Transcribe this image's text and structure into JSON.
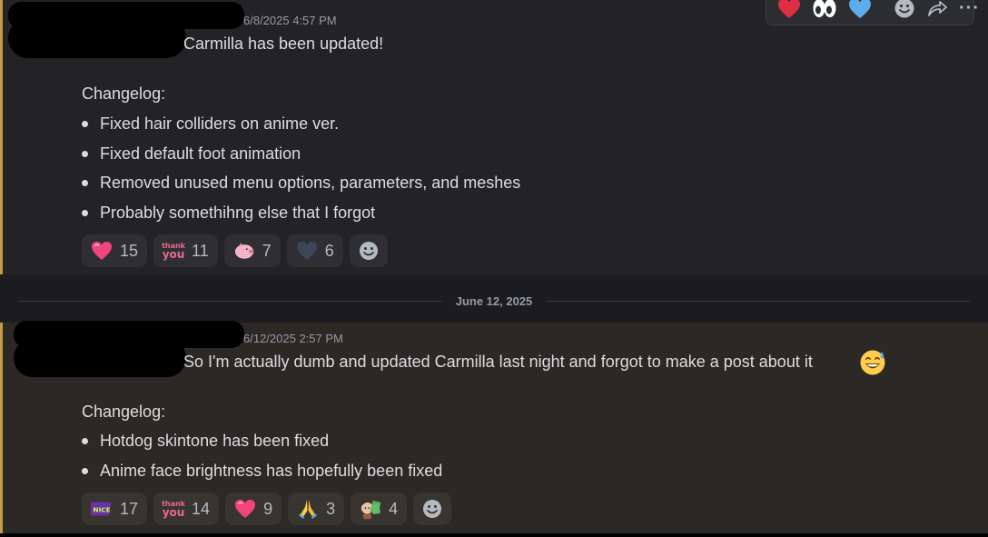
{
  "toolbar": {
    "quick_reactions": [
      "heart-emoji",
      "eyes-emoji",
      "blue-heart-emoji"
    ],
    "buttons": [
      "add-reaction-icon",
      "forward-icon",
      "more-icon"
    ],
    "more_label": "···"
  },
  "date_divider": {
    "label": "June 12, 2025"
  },
  "messages": [
    {
      "timestamp": "6/8/2025 4:57 PM",
      "first_line": "Carmilla has been updated!",
      "changelog_title": "Changelog:",
      "bullets": [
        "Fixed hair colliders on anime ver.",
        "Fixed default foot animation",
        "Removed unused menu options, parameters, and meshes",
        "Probably somethihng else that I forgot"
      ],
      "reactions": [
        {
          "emoji": "pink-heart",
          "count": "15"
        },
        {
          "emoji": "thank-you",
          "count": "11",
          "line1": "thank",
          "line2": "you"
        },
        {
          "emoji": "pink-pig",
          "count": "7"
        },
        {
          "emoji": "dark-heart",
          "count": "6"
        }
      ]
    },
    {
      "timestamp": "6/12/2025 2:57 PM",
      "first_line": "So I'm actually dumb and updated Carmilla last night and forgot to make a post about it",
      "trailing_emoji": "grinning-sweat-emoji",
      "changelog_title": "Changelog:",
      "bullets": [
        "Hotdog skintone has been fixed",
        "Anime face brightness has hopefully been fixed"
      ],
      "reactions": [
        {
          "emoji": "nice",
          "count": "17",
          "label": "NICE"
        },
        {
          "emoji": "thank-you",
          "count": "14",
          "line1": "thank",
          "line2": "you"
        },
        {
          "emoji": "pink-heart",
          "count": "9"
        },
        {
          "emoji": "praying-hands",
          "count": "3"
        },
        {
          "emoji": "money-sticker",
          "count": "4"
        }
      ]
    }
  ],
  "colors": {
    "accent_bar": "#c59a47",
    "reaction_bg": "#2e2e33",
    "text": "#dbdee1",
    "muted": "#949ba4"
  }
}
